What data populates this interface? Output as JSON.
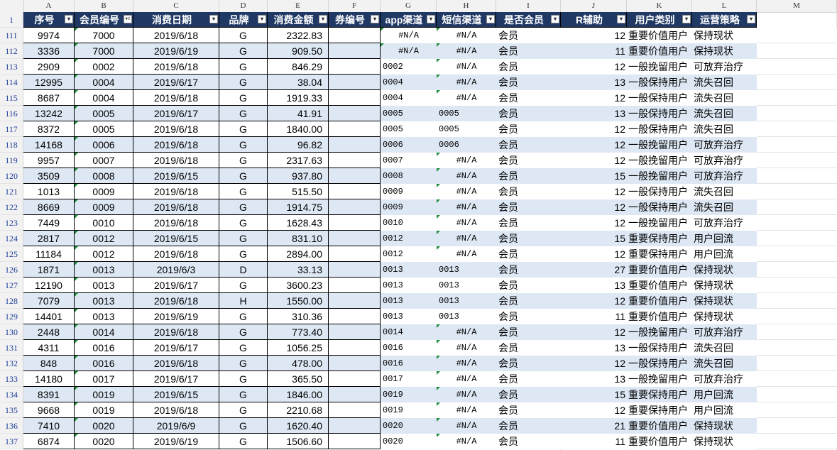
{
  "sheet": {
    "column_letters": [
      "A",
      "B",
      "C",
      "D",
      "E",
      "F",
      "G",
      "H",
      "I",
      "J",
      "K",
      "L",
      "M"
    ],
    "header_row_number": "1",
    "headers": [
      "序号",
      "会员编号",
      "消费日期",
      "品牌",
      "消费金额",
      "券编号",
      "app渠道",
      "短信渠道",
      "是否会员",
      "R辅助",
      "用户类别",
      "运营策略"
    ],
    "rows": [
      {
        "n": "111",
        "a": "9974",
        "b": "7000",
        "c": "2019/6/18",
        "d": "G",
        "e": "2322.83",
        "g": "#N/A",
        "h": "#N/A",
        "i": "会员",
        "j": "12",
        "k": "重要价值用户",
        "l": "保持现状"
      },
      {
        "n": "112",
        "a": "3336",
        "b": "7000",
        "c": "2019/6/19",
        "d": "G",
        "e": "909.50",
        "g": "#N/A",
        "h": "#N/A",
        "i": "会员",
        "j": "11",
        "k": "重要价值用户",
        "l": "保持现状"
      },
      {
        "n": "113",
        "a": "2909",
        "b": "0002",
        "c": "2019/6/18",
        "d": "G",
        "e": "846.29",
        "g": "0002",
        "h": "#N/A",
        "i": "会员",
        "j": "12",
        "k": "一般挽留用户",
        "l": "可放弃治疗"
      },
      {
        "n": "114",
        "a": "12995",
        "b": "0004",
        "c": "2019/6/17",
        "d": "G",
        "e": "38.04",
        "g": "0004",
        "h": "#N/A",
        "i": "会员",
        "j": "13",
        "k": "一般保持用户",
        "l": "流失召回"
      },
      {
        "n": "115",
        "a": "8687",
        "b": "0004",
        "c": "2019/6/18",
        "d": "G",
        "e": "1919.33",
        "g": "0004",
        "h": "#N/A",
        "i": "会员",
        "j": "12",
        "k": "一般保持用户",
        "l": "流失召回"
      },
      {
        "n": "116",
        "a": "13242",
        "b": "0005",
        "c": "2019/6/17",
        "d": "G",
        "e": "41.91",
        "g": "0005",
        "h": "0005",
        "i": "会员",
        "j": "13",
        "k": "一般保持用户",
        "l": "流失召回"
      },
      {
        "n": "117",
        "a": "8372",
        "b": "0005",
        "c": "2019/6/18",
        "d": "G",
        "e": "1840.00",
        "g": "0005",
        "h": "0005",
        "i": "会员",
        "j": "12",
        "k": "一般保持用户",
        "l": "流失召回"
      },
      {
        "n": "118",
        "a": "14168",
        "b": "0006",
        "c": "2019/6/18",
        "d": "G",
        "e": "96.82",
        "g": "0006",
        "h": "0006",
        "i": "会员",
        "j": "12",
        "k": "一般挽留用户",
        "l": "可放弃治疗"
      },
      {
        "n": "119",
        "a": "9957",
        "b": "0007",
        "c": "2019/6/18",
        "d": "G",
        "e": "2317.63",
        "g": "0007",
        "h": "#N/A",
        "i": "会员",
        "j": "12",
        "k": "一般挽留用户",
        "l": "可放弃治疗"
      },
      {
        "n": "120",
        "a": "3509",
        "b": "0008",
        "c": "2019/6/15",
        "d": "G",
        "e": "937.80",
        "g": "0008",
        "h": "#N/A",
        "i": "会员",
        "j": "15",
        "k": "一般挽留用户",
        "l": "可放弃治疗"
      },
      {
        "n": "121",
        "a": "1013",
        "b": "0009",
        "c": "2019/6/18",
        "d": "G",
        "e": "515.50",
        "g": "0009",
        "h": "#N/A",
        "i": "会员",
        "j": "12",
        "k": "一般保持用户",
        "l": "流失召回"
      },
      {
        "n": "122",
        "a": "8669",
        "b": "0009",
        "c": "2019/6/18",
        "d": "G",
        "e": "1914.75",
        "g": "0009",
        "h": "#N/A",
        "i": "会员",
        "j": "12",
        "k": "一般保持用户",
        "l": "流失召回"
      },
      {
        "n": "123",
        "a": "7449",
        "b": "0010",
        "c": "2019/6/18",
        "d": "G",
        "e": "1628.43",
        "g": "0010",
        "h": "#N/A",
        "i": "会员",
        "j": "12",
        "k": "一般挽留用户",
        "l": "可放弃治疗"
      },
      {
        "n": "124",
        "a": "2817",
        "b": "0012",
        "c": "2019/6/15",
        "d": "G",
        "e": "831.10",
        "g": "0012",
        "h": "#N/A",
        "i": "会员",
        "j": "15",
        "k": "重要保持用户",
        "l": "用户回流"
      },
      {
        "n": "125",
        "a": "11184",
        "b": "0012",
        "c": "2019/6/18",
        "d": "G",
        "e": "2894.00",
        "g": "0012",
        "h": "#N/A",
        "i": "会员",
        "j": "12",
        "k": "重要保持用户",
        "l": "用户回流"
      },
      {
        "n": "126",
        "a": "1871",
        "b": "0013",
        "c": "2019/6/3",
        "d": "D",
        "e": "33.13",
        "g": "0013",
        "h": "0013",
        "i": "会员",
        "j": "27",
        "k": "重要价值用户",
        "l": "保持现状"
      },
      {
        "n": "127",
        "a": "12190",
        "b": "0013",
        "c": "2019/6/17",
        "d": "G",
        "e": "3600.23",
        "g": "0013",
        "h": "0013",
        "i": "会员",
        "j": "13",
        "k": "重要价值用户",
        "l": "保持现状"
      },
      {
        "n": "128",
        "a": "7079",
        "b": "0013",
        "c": "2019/6/18",
        "d": "H",
        "e": "1550.00",
        "g": "0013",
        "h": "0013",
        "i": "会员",
        "j": "12",
        "k": "重要价值用户",
        "l": "保持现状"
      },
      {
        "n": "129",
        "a": "14401",
        "b": "0013",
        "c": "2019/6/19",
        "d": "G",
        "e": "310.36",
        "g": "0013",
        "h": "0013",
        "i": "会员",
        "j": "11",
        "k": "重要价值用户",
        "l": "保持现状"
      },
      {
        "n": "130",
        "a": "2448",
        "b": "0014",
        "c": "2019/6/18",
        "d": "G",
        "e": "773.40",
        "g": "0014",
        "h": "#N/A",
        "i": "会员",
        "j": "12",
        "k": "一般挽留用户",
        "l": "可放弃治疗"
      },
      {
        "n": "131",
        "a": "4311",
        "b": "0016",
        "c": "2019/6/17",
        "d": "G",
        "e": "1056.25",
        "g": "0016",
        "h": "#N/A",
        "i": "会员",
        "j": "13",
        "k": "一般保持用户",
        "l": "流失召回"
      },
      {
        "n": "132",
        "a": "848",
        "b": "0016",
        "c": "2019/6/18",
        "d": "G",
        "e": "478.00",
        "g": "0016",
        "h": "#N/A",
        "i": "会员",
        "j": "12",
        "k": "一般保持用户",
        "l": "流失召回"
      },
      {
        "n": "133",
        "a": "14180",
        "b": "0017",
        "c": "2019/6/17",
        "d": "G",
        "e": "365.50",
        "g": "0017",
        "h": "#N/A",
        "i": "会员",
        "j": "13",
        "k": "一般挽留用户",
        "l": "可放弃治疗"
      },
      {
        "n": "134",
        "a": "8391",
        "b": "0019",
        "c": "2019/6/15",
        "d": "G",
        "e": "1846.00",
        "g": "0019",
        "h": "#N/A",
        "i": "会员",
        "j": "15",
        "k": "重要保持用户",
        "l": "用户回流"
      },
      {
        "n": "135",
        "a": "9668",
        "b": "0019",
        "c": "2019/6/18",
        "d": "G",
        "e": "2210.68",
        "g": "0019",
        "h": "#N/A",
        "i": "会员",
        "j": "12",
        "k": "重要保持用户",
        "l": "用户回流"
      },
      {
        "n": "136",
        "a": "7410",
        "b": "0020",
        "c": "2019/6/9",
        "d": "G",
        "e": "1620.40",
        "g": "0020",
        "h": "#N/A",
        "i": "会员",
        "j": "21",
        "k": "重要价值用户",
        "l": "保持现状"
      },
      {
        "n": "137",
        "a": "6874",
        "b": "0020",
        "c": "2019/6/19",
        "d": "G",
        "e": "1506.60",
        "g": "0020",
        "h": "#N/A",
        "i": "会员",
        "j": "11",
        "k": "重要价值用户",
        "l": "保持现状"
      }
    ]
  },
  "colors": {
    "header_bg": "#1f3864",
    "band_bg": "#dde8f4",
    "row_number_text": "#1f3f99",
    "error_triangle": "#1e8c3a"
  },
  "icons": {
    "filter": "filter-dropdown-icon",
    "filter_active": "filter-active-icon"
  }
}
